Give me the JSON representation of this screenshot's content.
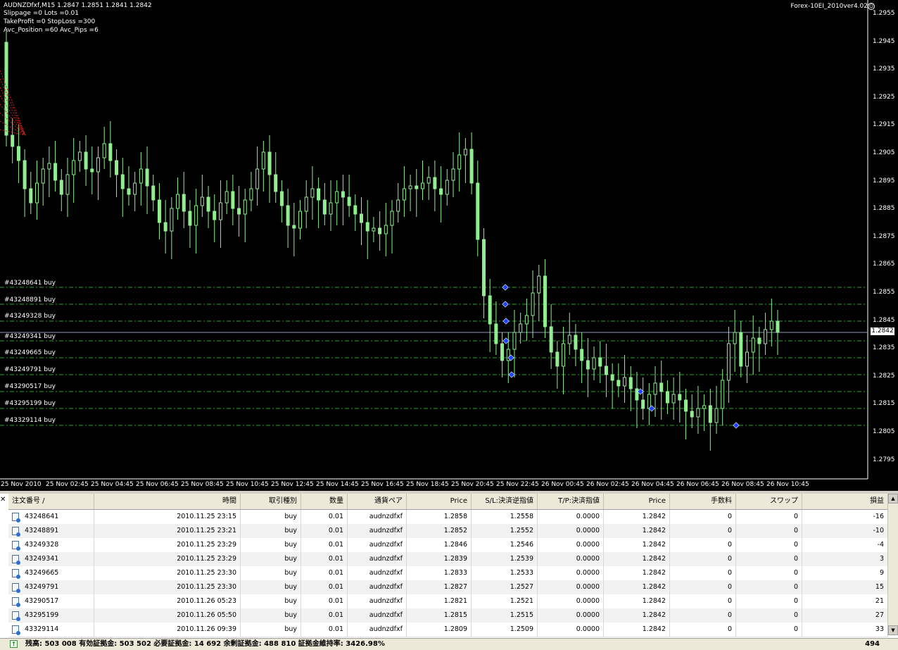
{
  "chart": {
    "header_lines": [
      "AUDNZDfxf,M15  1.2847 1.2851 1.2841 1.2842",
      "Slippage =0 Lots =0.01",
      "TakeProfit =0 StopLoss =300",
      "Avc_Position =60 Avc_Pips =6"
    ],
    "ea_name": "Forex-10EI_2010ver4.02",
    "smiley_icon": "smiley-icon",
    "current_price": "1.2842",
    "order_labels": [
      "#43248641 buy",
      "#43248891 buy",
      "#43249328 buy",
      "#43249341 buy",
      "#43249665 buy",
      "#43249791 buy",
      "#43290517 buy",
      "#43295199 buy",
      "#43329114 buy"
    ],
    "price_ticks": [
      "1.2955",
      "1.2945",
      "1.2935",
      "1.2925",
      "1.2915",
      "1.2905",
      "1.2895",
      "1.2885",
      "1.2875",
      "1.2865",
      "1.2855",
      "1.2845",
      "1.2835",
      "1.2825",
      "1.2815",
      "1.2805",
      "1.2795"
    ],
    "time_ticks": [
      "25 Nov 2010",
      "25 Nov 02:45",
      "25 Nov 04:45",
      "25 Nov 06:45",
      "25 Nov 08:45",
      "25 Nov 10:45",
      "25 Nov 12:45",
      "25 Nov 14:45",
      "25 Nov 16:45",
      "25 Nov 18:45",
      "25 Nov 20:45",
      "25 Nov 22:45",
      "26 Nov 00:45",
      "26 Nov 02:45",
      "26 Nov 04:45",
      "26 Nov 06:45",
      "26 Nov 08:45",
      "26 Nov 10:45"
    ],
    "colors": {
      "background": "#000000",
      "candle": "#90ee90",
      "order_line": "#22aa22",
      "current_line": "#8899bb",
      "marker": "#2244ff"
    }
  },
  "terminal": {
    "close_icon": "close-icon",
    "columns": [
      "注文番号 /",
      "時間",
      "取引種別",
      "数量",
      "通貨ペア",
      "Price",
      "S/L:決済逆指値",
      "T/P:決済指値",
      "Price",
      "手数料",
      "スワップ",
      "損益"
    ],
    "rows": [
      [
        "43248641",
        "2010.11.25 23:15",
        "buy",
        "0.01",
        "audnzdfxf",
        "1.2858",
        "1.2558",
        "0.0000",
        "1.2842",
        "0",
        "0",
        "-16"
      ],
      [
        "43248891",
        "2010.11.25 23:21",
        "buy",
        "0.01",
        "audnzdfxf",
        "1.2852",
        "1.2552",
        "0.0000",
        "1.2842",
        "0",
        "0",
        "-10"
      ],
      [
        "43249328",
        "2010.11.25 23:29",
        "buy",
        "0.01",
        "audnzdfxf",
        "1.2846",
        "1.2546",
        "0.0000",
        "1.2842",
        "0",
        "0",
        "-4"
      ],
      [
        "43249341",
        "2010.11.25 23:29",
        "buy",
        "0.01",
        "audnzdfxf",
        "1.2839",
        "1.2539",
        "0.0000",
        "1.2842",
        "0",
        "0",
        "3"
      ],
      [
        "43249665",
        "2010.11.25 23:30",
        "buy",
        "0.01",
        "audnzdfxf",
        "1.2833",
        "1.2533",
        "0.0000",
        "1.2842",
        "0",
        "0",
        "9"
      ],
      [
        "43249791",
        "2010.11.25 23:30",
        "buy",
        "0.01",
        "audnzdfxf",
        "1.2827",
        "1.2527",
        "0.0000",
        "1.2842",
        "0",
        "0",
        "15"
      ],
      [
        "43290517",
        "2010.11.26 05:23",
        "buy",
        "0.01",
        "audnzdfxf",
        "1.2821",
        "1.2521",
        "0.0000",
        "1.2842",
        "0",
        "0",
        "21"
      ],
      [
        "43295199",
        "2010.11.26 05:50",
        "buy",
        "0.01",
        "audnzdfxf",
        "1.2815",
        "1.2515",
        "0.0000",
        "1.2842",
        "0",
        "0",
        "27"
      ],
      [
        "43329114",
        "2010.11.26 09:39",
        "buy",
        "0.01",
        "audnzdfxf",
        "1.2809",
        "1.2509",
        "0.0000",
        "1.2842",
        "0",
        "0",
        "33"
      ]
    ],
    "status": {
      "text": "残高: 503 008  有効証拠金: 503 502  必要証拠金: 14 692  余剰証拠金: 488 810  証拠金維持率: 3426.98%",
      "total": "494"
    }
  }
}
